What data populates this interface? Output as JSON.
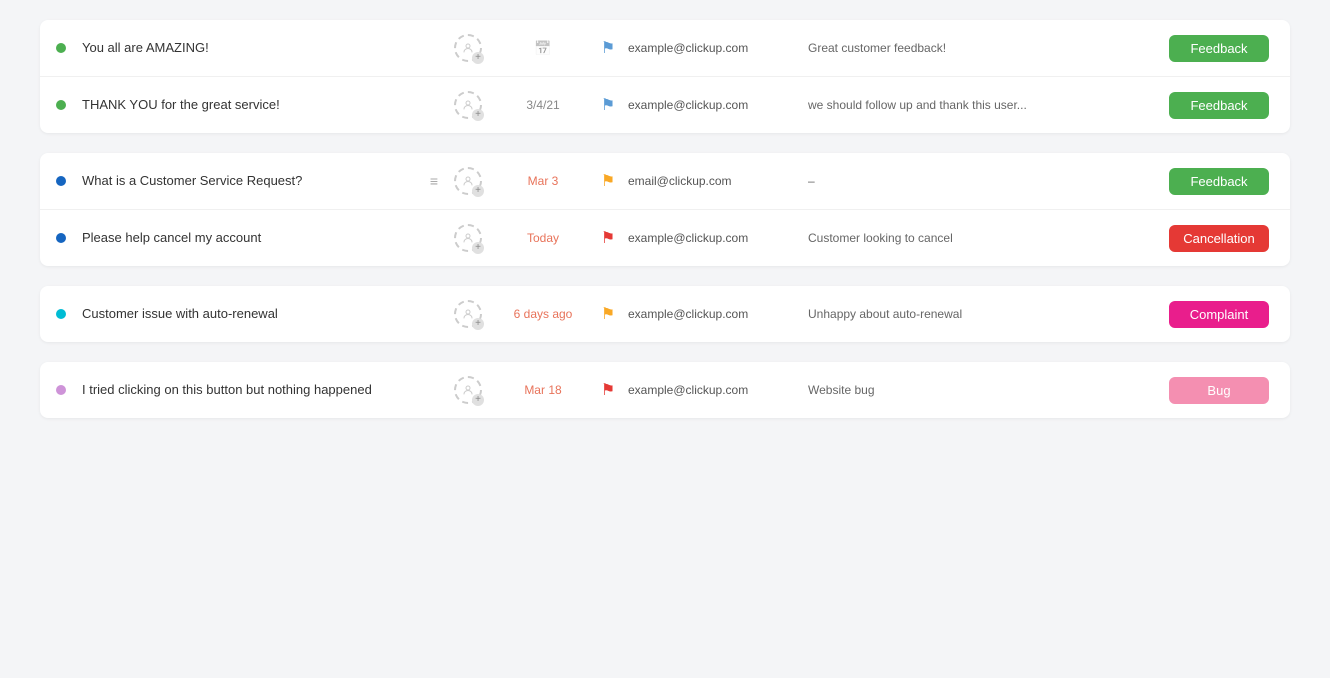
{
  "groups": [
    {
      "id": "group-1",
      "rows": [
        {
          "id": "row-1",
          "status_color": "#4caf50",
          "title": "You all are AMAZING!",
          "has_list_icon": false,
          "date_display": "",
          "date_type": "empty",
          "flag_color": "#5b9bd5",
          "email": "example@clickup.com",
          "note": "Great customer feedback!",
          "tag_label": "Feedback",
          "tag_class": "tag-feedback"
        },
        {
          "id": "row-2",
          "status_color": "#4caf50",
          "title": "THANK YOU for the great service!",
          "has_list_icon": false,
          "date_display": "3/4/21",
          "date_type": "normal",
          "flag_color": "#5b9bd5",
          "email": "example@clickup.com",
          "note": "we should follow up and thank this user...",
          "tag_label": "Feedback",
          "tag_class": "tag-feedback"
        }
      ]
    },
    {
      "id": "group-2",
      "rows": [
        {
          "id": "row-3",
          "status_color": "#1565c0",
          "title": "What is a Customer Service Request?",
          "has_list_icon": true,
          "date_display": "Mar 3",
          "date_type": "mar",
          "flag_color": "#f9a825",
          "email": "email@clickup.com",
          "note": "–",
          "tag_label": "Feedback",
          "tag_class": "tag-feedback"
        },
        {
          "id": "row-4",
          "status_color": "#1565c0",
          "title": "Please help cancel my account",
          "has_list_icon": false,
          "date_display": "Today",
          "date_type": "today",
          "flag_color": "#e53935",
          "email": "example@clickup.com",
          "note": "Customer looking to cancel",
          "tag_label": "Cancellation",
          "tag_class": "tag-cancellation"
        }
      ]
    },
    {
      "id": "group-3",
      "rows": [
        {
          "id": "row-5",
          "status_color": "#00bcd4",
          "title": "Customer issue with auto-renewal",
          "has_list_icon": false,
          "date_display": "6 days ago",
          "date_type": "days-ago",
          "flag_color": "#f9a825",
          "email": "example@clickup.com",
          "note": "Unhappy about auto-renewal",
          "tag_label": "Complaint",
          "tag_class": "tag-complaint"
        }
      ]
    },
    {
      "id": "group-4",
      "rows": [
        {
          "id": "row-6",
          "status_color": "#ce93d8",
          "title": "I tried clicking on this button but nothing happened",
          "has_list_icon": false,
          "date_display": "Mar 18",
          "date_type": "mar",
          "flag_color": "#e53935",
          "email": "example@clickup.com",
          "note": "Website bug",
          "tag_label": "Bug",
          "tag_class": "tag-bug"
        }
      ]
    }
  ],
  "labels": {
    "feedback": "Feedback",
    "cancellation": "Cancellation",
    "complaint": "Complaint",
    "bug": "Bug",
    "today": "Today",
    "dash": "–"
  }
}
